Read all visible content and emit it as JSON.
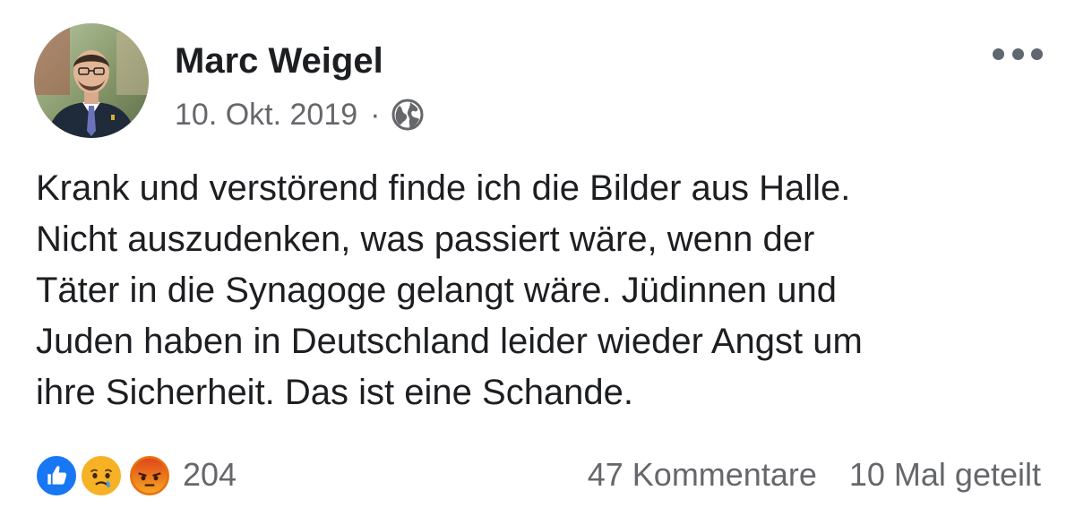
{
  "post": {
    "author": "Marc Weigel",
    "date": "10. Okt. 2019",
    "separator": "·",
    "privacy_icon": "globe-icon",
    "more_icon": "more-options-icon",
    "body": "Krank und verstörend finde ich die Bilder aus Halle.\nNicht auszudenken, was passiert wäre, wenn der\nTäter in die Synagoge gelangt wäre. Jüdinnen und\nJuden haben in Deutschland leider wieder Angst um\nihre Sicherheit. Das ist eine Schande."
  },
  "footer": {
    "reactions": [
      "like",
      "sad",
      "angry"
    ],
    "reaction_count": "204",
    "comments": "47 Kommentare",
    "shares": "10 Mal geteilt"
  },
  "colors": {
    "like": "#1877f2",
    "sad": "#f7b125",
    "angry": "#e9710f",
    "secondary_text": "#65676b"
  }
}
